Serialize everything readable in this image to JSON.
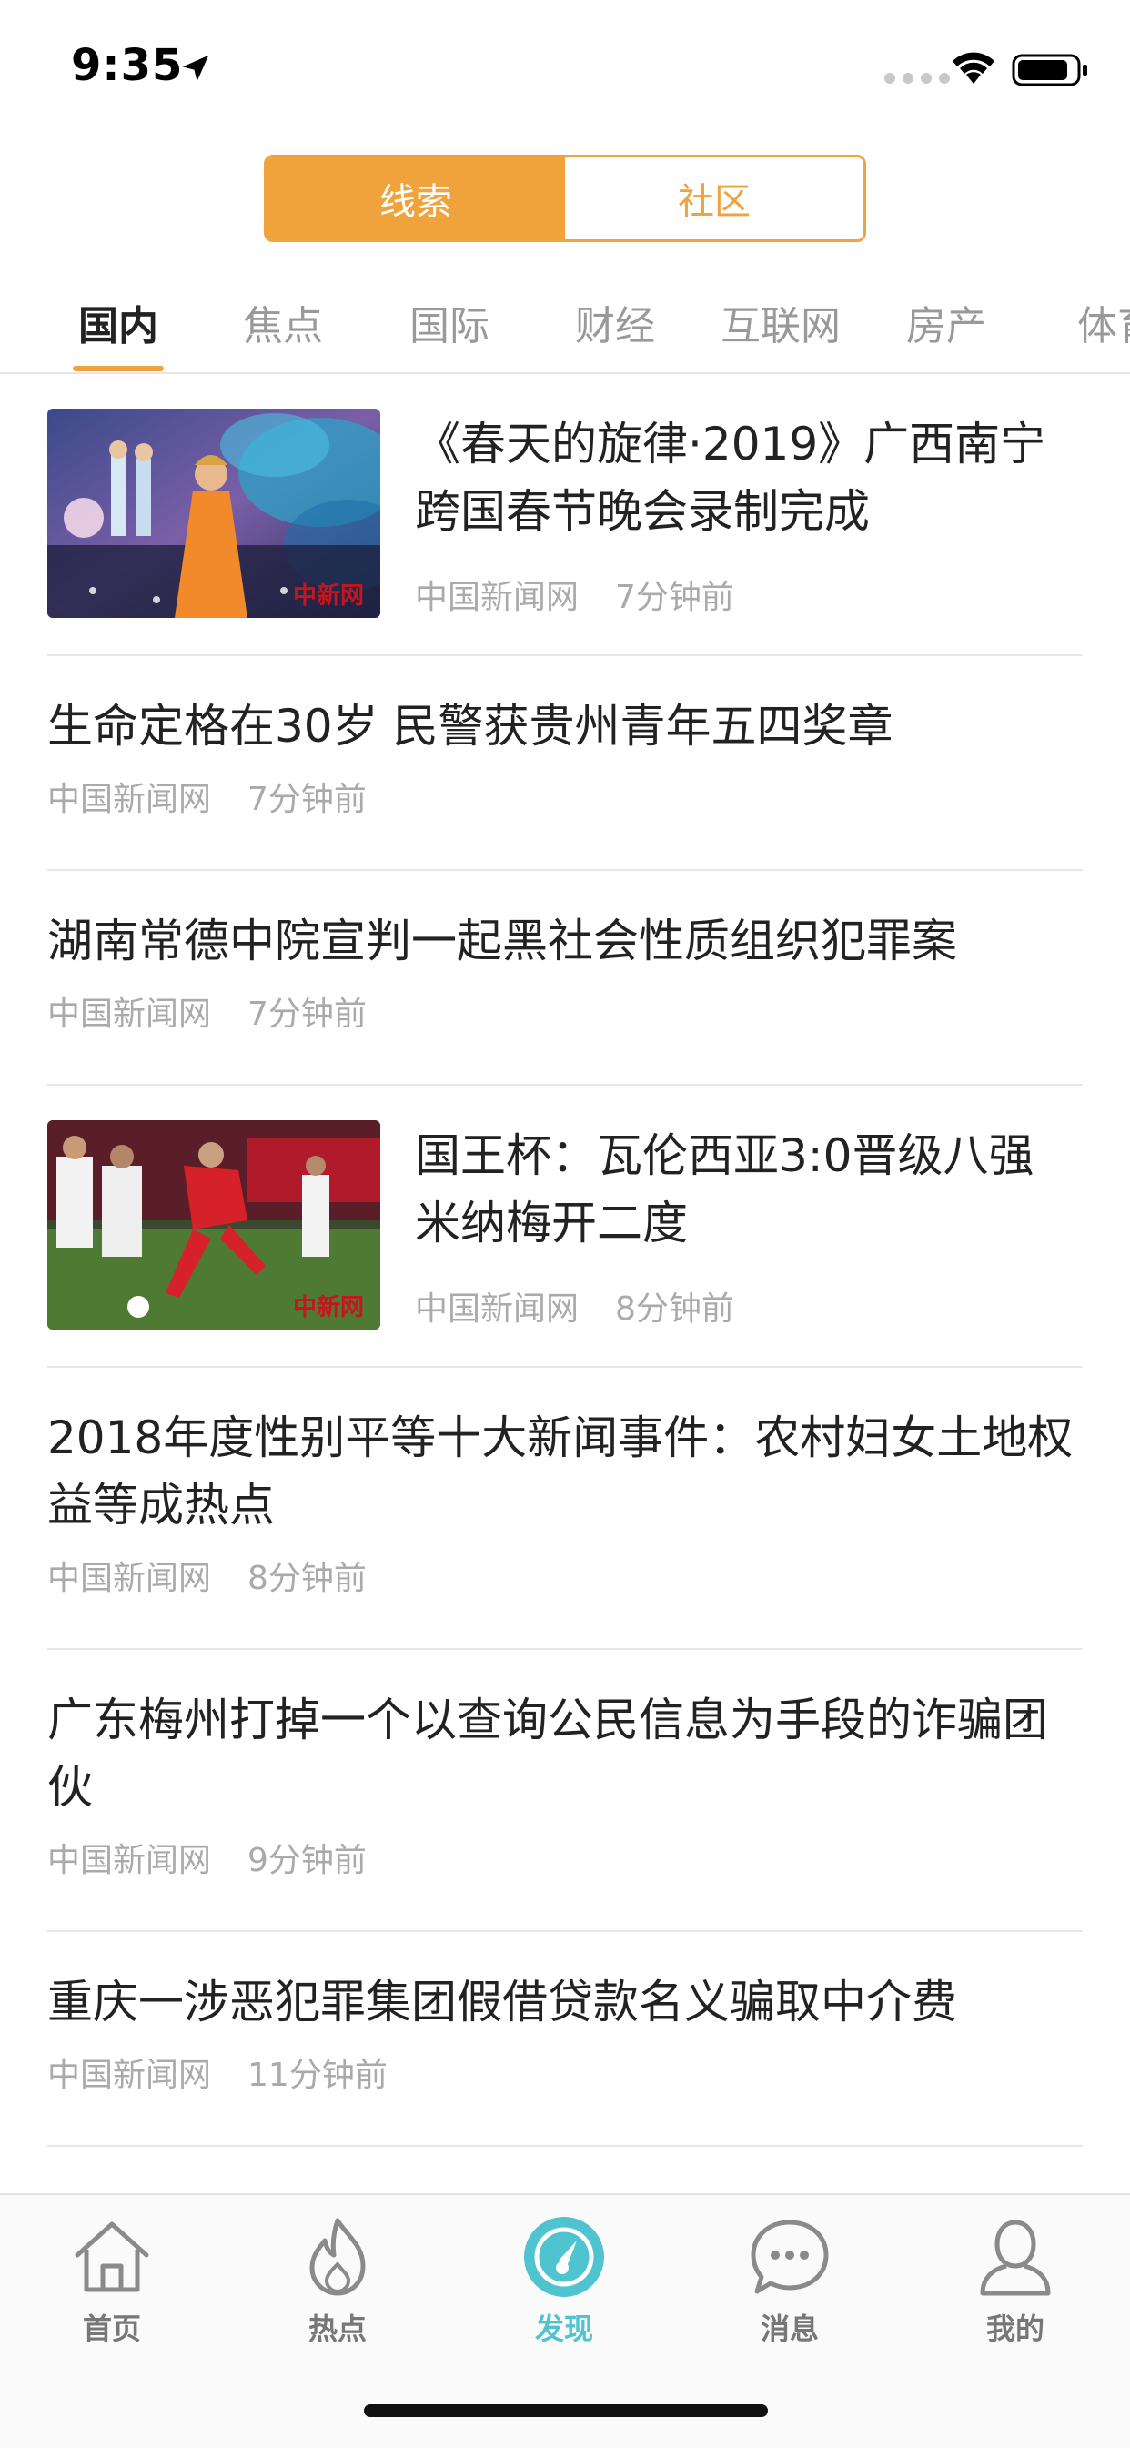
{
  "status_bar": {
    "time": "9:35"
  },
  "segment": {
    "tabs": [
      "线索",
      "社区"
    ],
    "active_index": 0
  },
  "categories": {
    "items": [
      "国内",
      "焦点",
      "国际",
      "财经",
      "互联网",
      "房产",
      "体育"
    ],
    "active_index": 0
  },
  "news": [
    {
      "title": "《春天的旋律·2019》广西南宁跨国春节晚会录制完成",
      "source": "中国新闻网",
      "time": "7分钟前",
      "has_image": true,
      "image_icon": "concert-photo"
    },
    {
      "title": "生命定格在30岁 民警获贵州青年五四奖章",
      "source": "中国新闻网",
      "time": "7分钟前",
      "has_image": false
    },
    {
      "title": "湖南常德中院宣判一起黑社会性质组织犯罪案",
      "source": "中国新闻网",
      "time": "7分钟前",
      "has_image": false
    },
    {
      "title": "国王杯：瓦伦西亚3:0晋级八强 米纳梅开二度",
      "source": "中国新闻网",
      "time": "8分钟前",
      "has_image": true,
      "image_icon": "football-photo"
    },
    {
      "title": "2018年度性别平等十大新闻事件：农村妇女土地权益等成热点",
      "source": "中国新闻网",
      "time": "8分钟前",
      "has_image": false
    },
    {
      "title": "广东梅州打掉一个以查询公民信息为手段的诈骗团伙",
      "source": "中国新闻网",
      "time": "9分钟前",
      "has_image": false
    },
    {
      "title": "重庆一涉恶犯罪集团假借贷款名义骗取中介费",
      "source": "中国新闻网",
      "time": "11分钟前",
      "has_image": false
    }
  ],
  "image_stamp": "中新网",
  "tabbar": {
    "items": [
      {
        "label": "首页",
        "icon": "home-icon"
      },
      {
        "label": "热点",
        "icon": "flame-icon"
      },
      {
        "label": "发现",
        "icon": "compass-icon"
      },
      {
        "label": "消息",
        "icon": "chat-icon"
      },
      {
        "label": "我的",
        "icon": "person-icon"
      }
    ],
    "active_index": 2
  },
  "colors": {
    "accent": "#f0a33c",
    "active_tab": "#4fc3cf",
    "meta_text": "#aaaaaa"
  }
}
